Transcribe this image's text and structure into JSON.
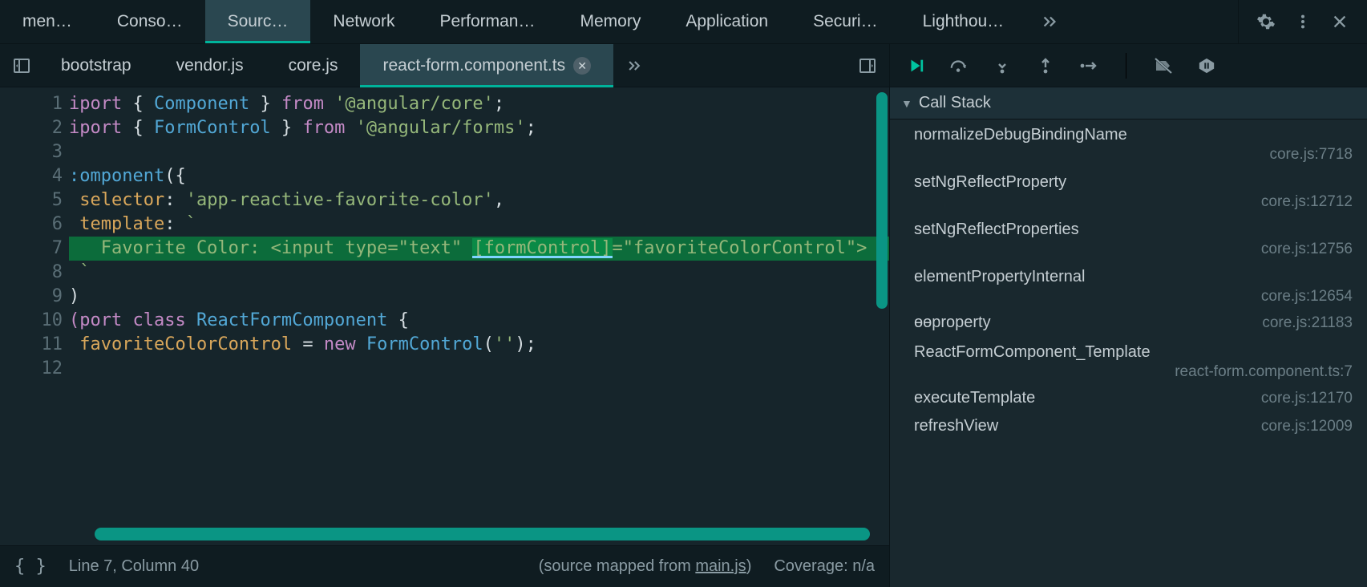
{
  "mainTabs": {
    "items": [
      "men…",
      "Conso…",
      "Sourc…",
      "Network",
      "Performan…",
      "Memory",
      "Application",
      "Securi…",
      "Lighthou…"
    ],
    "activeIndex": 2
  },
  "fileTabs": {
    "items": [
      "bootstrap",
      "vendor.js",
      "core.js",
      "react-form.component.ts"
    ],
    "activeIndex": 3
  },
  "editor": {
    "highlightLine": 7,
    "lines": [
      {
        "n": 1,
        "seg": [
          [
            "p",
            "iport"
          ],
          [
            "w",
            " { "
          ],
          [
            "c",
            "Component"
          ],
          [
            "w",
            " } "
          ],
          [
            "p",
            "from"
          ],
          [
            "w",
            " "
          ],
          [
            "g",
            "'@angular/core'"
          ],
          [
            "w",
            ";"
          ]
        ]
      },
      {
        "n": 2,
        "seg": [
          [
            "p",
            "iport"
          ],
          [
            "w",
            " { "
          ],
          [
            "c",
            "FormControl"
          ],
          [
            "w",
            " } "
          ],
          [
            "p",
            "from"
          ],
          [
            "w",
            " "
          ],
          [
            "g",
            "'@angular/forms'"
          ],
          [
            "w",
            ";"
          ]
        ]
      },
      {
        "n": 3,
        "seg": []
      },
      {
        "n": 4,
        "seg": [
          [
            "c",
            ":omponent"
          ],
          [
            "w",
            "({"
          ]
        ]
      },
      {
        "n": 5,
        "seg": [
          [
            "o",
            " selector"
          ],
          [
            "w",
            ": "
          ],
          [
            "g",
            "'app-reactive-favorite-color'"
          ],
          [
            "w",
            ","
          ]
        ]
      },
      {
        "n": 6,
        "seg": [
          [
            "o",
            " template"
          ],
          [
            "w",
            ": "
          ],
          [
            "g",
            "`"
          ]
        ]
      },
      {
        "n": 7,
        "seg": [
          [
            "g",
            "   Favorite Color: <input type=\"text\" "
          ],
          [
            "hl",
            "[formControl]"
          ],
          [
            "g",
            "=\"favoriteColorControl\">"
          ]
        ]
      },
      {
        "n": 8,
        "seg": [
          [
            "g",
            " `"
          ]
        ]
      },
      {
        "n": 9,
        "seg": [
          [
            "w",
            ")"
          ]
        ]
      },
      {
        "n": 10,
        "seg": [
          [
            "p",
            "(port"
          ],
          [
            "w",
            " "
          ],
          [
            "p",
            "class"
          ],
          [
            "w",
            " "
          ],
          [
            "c",
            "ReactFormComponent"
          ],
          [
            "w",
            " {"
          ]
        ]
      },
      {
        "n": 11,
        "seg": [
          [
            "o",
            " favoriteColorControl"
          ],
          [
            "w",
            " = "
          ],
          [
            "p",
            "new"
          ],
          [
            "w",
            " "
          ],
          [
            "c",
            "FormControl"
          ],
          [
            "w",
            "("
          ],
          [
            "g",
            "''"
          ],
          [
            "w",
            ");"
          ]
        ]
      },
      {
        "n": 12,
        "seg": []
      }
    ]
  },
  "status": {
    "braces": "{ }",
    "cursor": "Line 7, Column 40",
    "mappedPrefix": "(source mapped from ",
    "mappedFile": "main.js",
    "mappedSuffix": ")",
    "coverage": "Coverage: n/a"
  },
  "callStack": {
    "title": "Call Stack",
    "frames": [
      {
        "fn": "normalizeDebugBindingName",
        "loc": "core.js:7718",
        "two": true
      },
      {
        "fn": "setNgReflectProperty",
        "loc": "core.js:12712",
        "two": true
      },
      {
        "fn": "setNgReflectProperties",
        "loc": "core.js:12756",
        "two": true
      },
      {
        "fn": "elementPropertyInternal",
        "loc": "core.js:12654",
        "two": true
      },
      {
        "fn": "ɵɵproperty",
        "loc": "core.js:21183",
        "two": false
      },
      {
        "fn": "ReactFormComponent_Template",
        "loc": "react-form.component.ts:7",
        "two": true
      },
      {
        "fn": "executeTemplate",
        "loc": "core.js:12170",
        "two": false
      },
      {
        "fn": "refreshView",
        "loc": "core.js:12009",
        "two": false
      }
    ]
  }
}
